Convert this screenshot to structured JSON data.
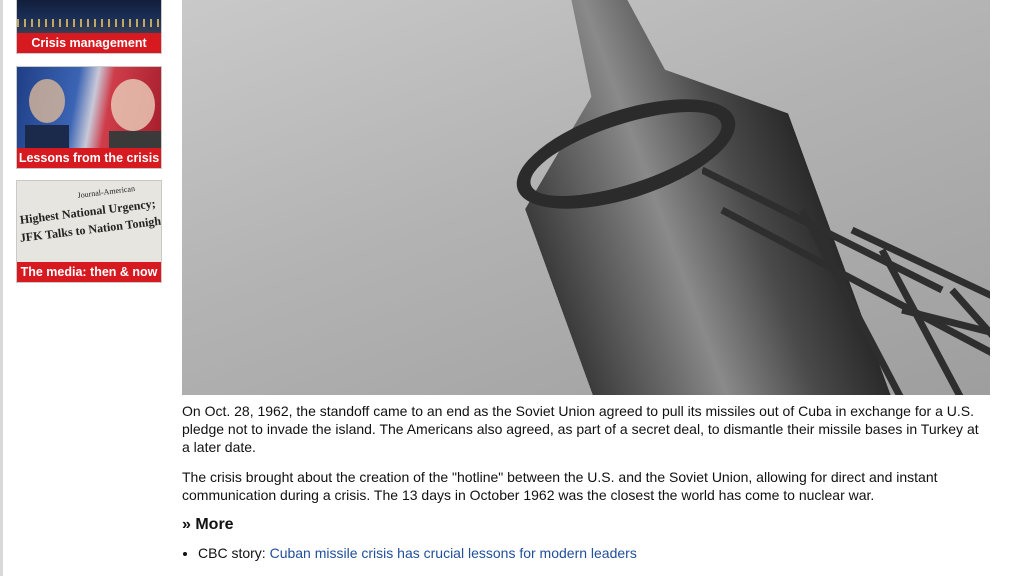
{
  "sidebar": {
    "promos": [
      {
        "label": "Crisis management"
      },
      {
        "label": "Lessons from the crisis"
      },
      {
        "label": "The media: then & now"
      }
    ],
    "newspaper": {
      "masthead": "Journal-American",
      "headline_1": "Highest National Urgency;",
      "headline_2": "JFK Talks to Nation Tonight"
    }
  },
  "main": {
    "paragraphs": [
      "On Oct. 28, 1962, the standoff came to an end as the Soviet Union agreed to pull its missiles out of Cuba in exchange for a U.S. pledge not to invade the island. The Americans also agreed, as part of a secret deal, to dismantle their missile bases in Turkey at a later date.",
      "The crisis brought about the creation of the \"hotline\" between the U.S. and the Soviet Union, allowing for direct and instant communication during a crisis. The 13 days in October 1962 was the closest the world has come to nuclear war."
    ],
    "more_heading": "» More",
    "links": [
      {
        "prefix": "CBC story: ",
        "text": "Cuban missile crisis has crucial lessons for modern leaders"
      }
    ]
  },
  "colors": {
    "accent": "#d71920",
    "link": "#1f4e9b"
  }
}
